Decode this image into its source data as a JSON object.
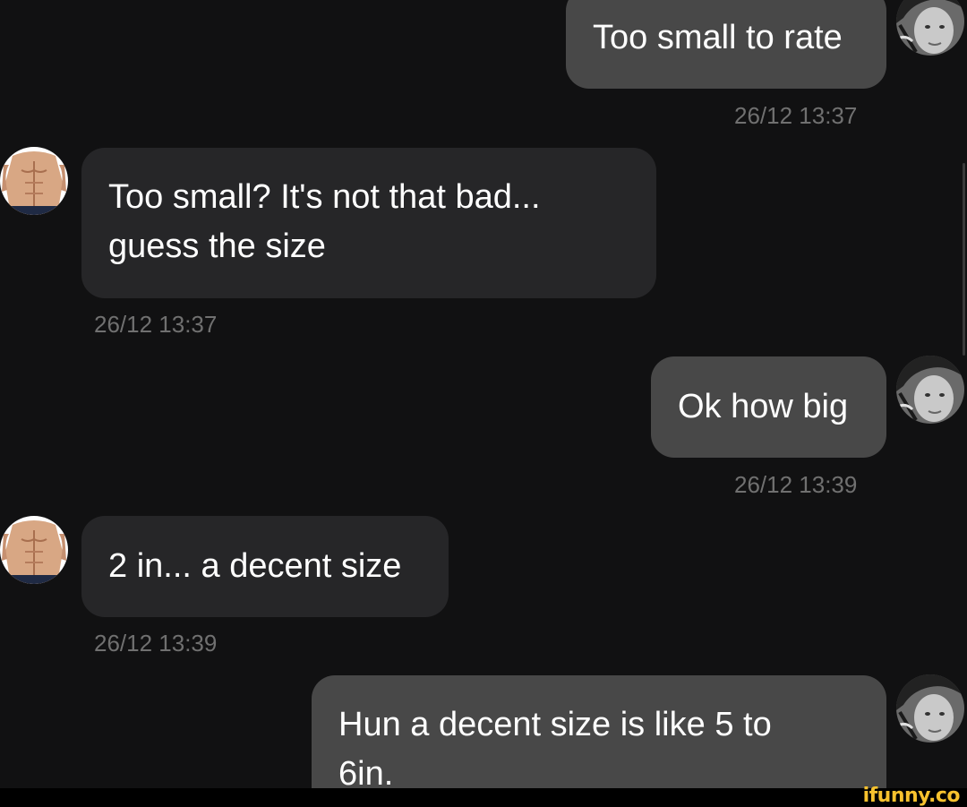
{
  "messages": [
    {
      "direction": "sent",
      "lines": [
        "Too small to rate"
      ],
      "timestamp": "26/12 13:37",
      "avatar_icon": "female-avatar-icon"
    },
    {
      "direction": "received",
      "lines": [
        "Too small? It's not that bad...",
        "guess the size"
      ],
      "timestamp": "26/12 13:37",
      "avatar_icon": "male-torso-avatar-icon"
    },
    {
      "direction": "sent",
      "lines": [
        "Ok how big"
      ],
      "timestamp": "26/12 13:39",
      "avatar_icon": "female-avatar-icon"
    },
    {
      "direction": "received",
      "lines": [
        "2 in... a decent size"
      ],
      "timestamp": "26/12 13:39",
      "avatar_icon": "male-torso-avatar-icon"
    },
    {
      "direction": "sent",
      "lines": [
        "Hun a decent size is like 5 to",
        "6in."
      ],
      "timestamp": "",
      "avatar_icon": "female-avatar-icon"
    }
  ],
  "watermark": "ifunny.co",
  "colors": {
    "background": "#111112",
    "sent_bubble": "#484848",
    "received_bubble": "#262628",
    "timestamp": "#707070",
    "watermark": "#f7c22e"
  }
}
